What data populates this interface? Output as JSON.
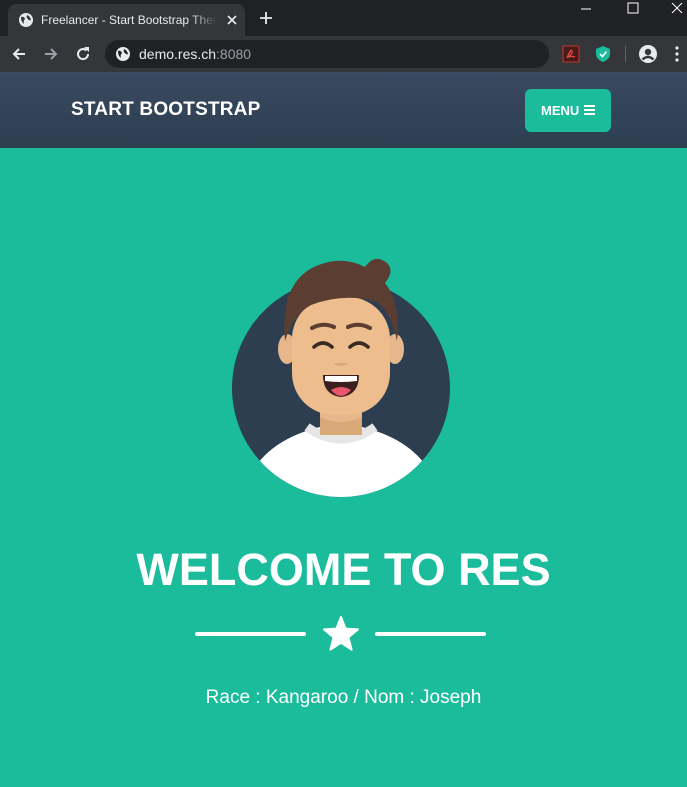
{
  "browser": {
    "tab_title": "Freelancer - Start Bootstrap Theme",
    "url_host": "demo.res.ch",
    "url_port": ":8080"
  },
  "site": {
    "brand": "START BOOTSTRAP",
    "menu_label": "MENU",
    "headline": "WELCOME TO RES",
    "subtitle": "Race : Kangaroo / Nom : Joseph"
  },
  "icons": {
    "tab_favicon": "globe-icon",
    "tab_close": "close-icon",
    "new_tab": "plus-icon",
    "site_info": "globe-icon",
    "extension_1": "pdf-icon",
    "extension_2": "shield-icon",
    "profile": "account-icon",
    "menu": "hamburger-icon",
    "divider": "star-icon"
  },
  "colors": {
    "primary": "#1abc9c",
    "navbar": "#2c3e50",
    "text_light": "#ffffff"
  }
}
